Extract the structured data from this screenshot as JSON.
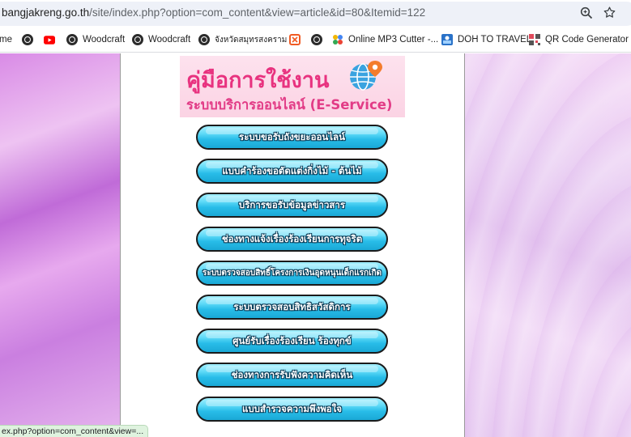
{
  "address_bar": {
    "host": "bangjakreng.go.th",
    "path": "/site/index.php?option=com_content&view=article&id=80&Itemid=122"
  },
  "bookmarks": [
    {
      "label": "me",
      "icon": "none"
    },
    {
      "label": "",
      "icon": "globe-icon"
    },
    {
      "label": "",
      "icon": "youtube-icon"
    },
    {
      "label": "Woodcraft",
      "icon": "globe-icon"
    },
    {
      "label": "Woodcraft",
      "icon": "globe-icon"
    },
    {
      "label": "จังหวัดสมุทรสงคราม",
      "icon": "globe-icon"
    },
    {
      "label": "",
      "icon": "orange-square-icon"
    },
    {
      "label": "",
      "icon": "globe-icon"
    },
    {
      "label": "Online MP3 Cutter -...",
      "icon": "mp3-cutter-icon"
    },
    {
      "label": "DOH TO TRAVEL",
      "icon": "doh-icon"
    },
    {
      "label": "QR Code Generator",
      "icon": "qr-icon"
    }
  ],
  "banner": {
    "title": "คู่มือการใช้งาน",
    "subtitle": "ระบบบริการออนไลน์ (E-Service)"
  },
  "services": [
    "ระบบขอรับถังขยะออนไลน์",
    "แบบคำร้องขอตัดแต่งกิ่งไม้ - ต้นไม้",
    "บริการขอรับข้อมูลข่าวสาร",
    "ช่องทางแจ้งเรื่องร้องเรียนการทุจริต",
    "ระบบตรวจสอบสิทธิ์โครงการเงินอุดหนุนเด็กแรกเกิด",
    "ระบบตรวจสอบสิทธิสวัสดิการ",
    "ศูนย์รับเรื่องร้องเรียน ร้องทุกข์",
    "ช่องทางการรับฟังความคิดเห็น",
    "แบบสำรวจความพึงพอใจ"
  ],
  "status_text": "ex.php?option=com_content&view=...",
  "colors": {
    "banner_pink": "#e8327f",
    "button_cyan": "#28bde8",
    "status_green": "#dff3df"
  }
}
